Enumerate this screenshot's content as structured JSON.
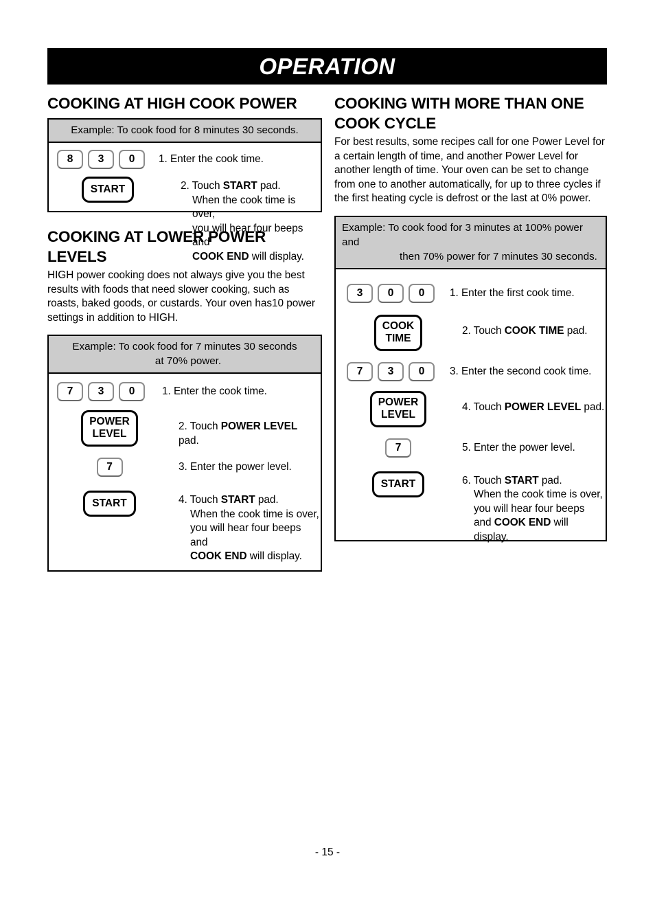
{
  "header": {
    "title": "OPERATION"
  },
  "footer": {
    "page_label": "- 15 -"
  },
  "colors": {
    "banner_bg": "#000000",
    "banner_text": "#ffffff",
    "example_head_bg": "#cccccc",
    "box_border": "#000000",
    "numkey_border": "#8d8d8d"
  },
  "sections": {
    "high_power": {
      "title": "COOKING AT HIGH COOK POWER",
      "example_line1": "Example: To cook food for 8 minutes 30 seconds.",
      "example_line2": "",
      "steps": [
        {
          "keys": [
            "8",
            "3",
            "0"
          ],
          "text": "1. Enter the cook time."
        },
        {
          "pad_line1": "START",
          "pad_line2": "",
          "text_main": "2. Touch ",
          "text_bold": "START",
          "text_tail": " pad.",
          "cont1": "When the cook time is over,",
          "cont2": "you will hear four beeps and",
          "cont3_bold": "COOK END",
          "cont3_tail": " will display."
        }
      ]
    },
    "lower_power": {
      "title": "COOKING AT LOWER POWER LEVELS",
      "body": "HIGH power cooking does not always give you the best results with foods that need slower cooking, such as roasts, baked goods, or custards. Your oven has10 power settings in addition to HIGH.",
      "example_line1": "Example: To cook food for 7 minutes 30 seconds",
      "example_line2": "at 70% power.",
      "steps": [
        {
          "keys": [
            "7",
            "3",
            "0"
          ],
          "text": "1. Enter the cook time."
        },
        {
          "pad_line1": "POWER",
          "pad_line2": "LEVEL",
          "text_main": "2. Touch ",
          "text_bold": "POWER LEVEL",
          "text_tail": " pad."
        },
        {
          "keys": [
            "7"
          ],
          "text": "3. Enter the power level."
        },
        {
          "pad_line1": "START",
          "pad_line2": "",
          "text_main": "4. Touch ",
          "text_bold": "START",
          "text_tail": " pad.",
          "cont1": "When the cook time is over,",
          "cont2": "you will hear four beeps and",
          "cont3_bold": "COOK END",
          "cont3_tail": " will display."
        }
      ]
    },
    "more_cycles": {
      "title": "COOKING WITH MORE THAN ONE COOK CYCLE",
      "body": "For best results, some recipes call for one Power Level for a certain length of time, and another Power Level for another length of time. Your oven can be set to change from one to another automatically, for up to three cycles if the first heating cycle is defrost or the last at 0% power.",
      "example_line1": "Example: To cook food for 3 minutes at 100% power and",
      "example_line2": "then 70% power for 7 minutes 30 seconds.",
      "steps": [
        {
          "keys": [
            "3",
            "0",
            "0"
          ],
          "text": "1. Enter the first cook time."
        },
        {
          "pad_line1": "COOK",
          "pad_line2": "TIME",
          "text_main": "2. Touch ",
          "text_bold": "COOK TIME",
          "text_tail": " pad."
        },
        {
          "keys": [
            "7",
            "3",
            "0"
          ],
          "text": "3. Enter the second cook time."
        },
        {
          "pad_line1": "POWER",
          "pad_line2": "LEVEL",
          "text_main": "4. Touch ",
          "text_bold": "POWER LEVEL",
          "text_tail": " pad."
        },
        {
          "keys": [
            "7"
          ],
          "text": "5. Enter the power level."
        },
        {
          "pad_line1": "START",
          "pad_line2": "",
          "text_main": "6. Touch ",
          "text_bold": "START",
          "text_tail": " pad.",
          "cont1": "When the cook time is over,",
          "cont2": "you will hear four beeps",
          "cont3_lead": "and ",
          "cont3_bold": "COOK END",
          "cont3_tail": " will display."
        }
      ]
    }
  }
}
